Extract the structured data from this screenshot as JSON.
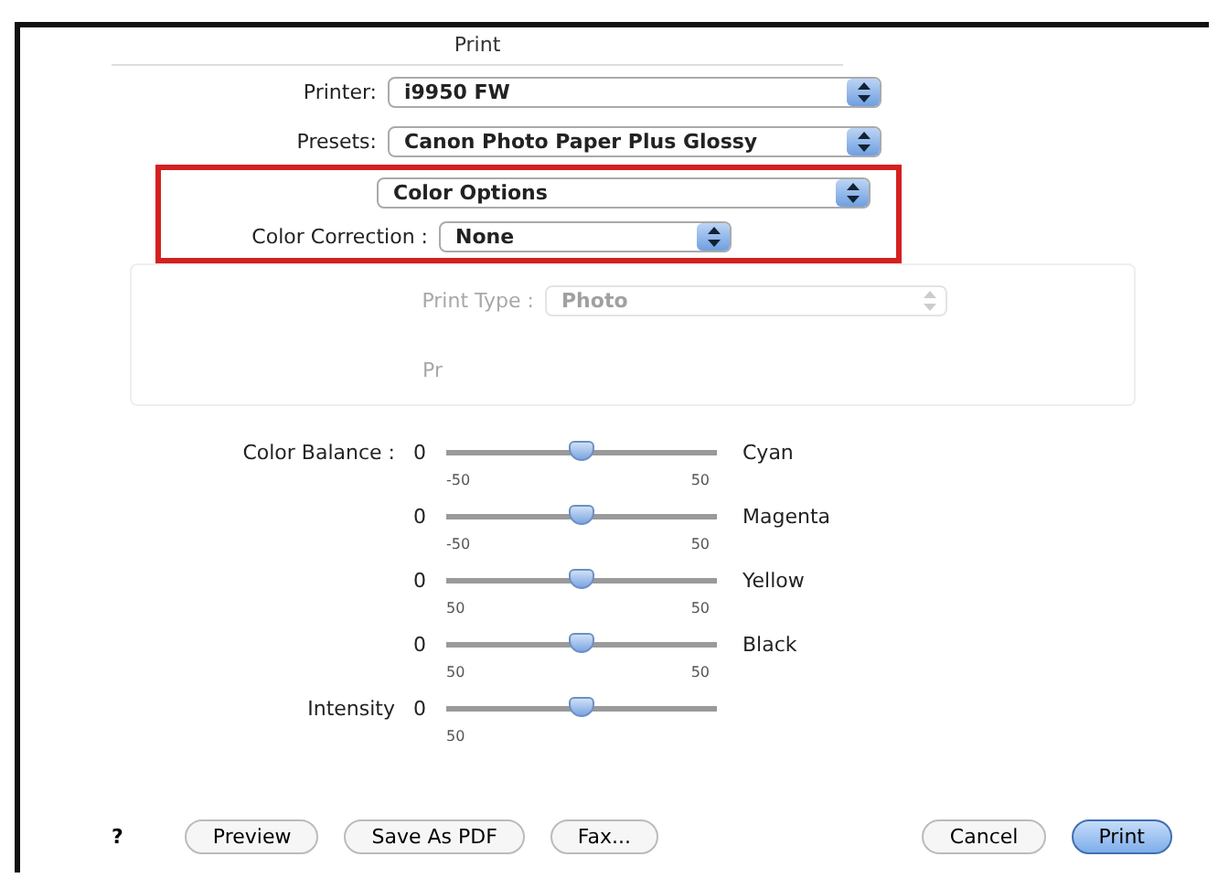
{
  "window": {
    "title": "Print"
  },
  "printer": {
    "label": "Printer:",
    "value": "i9950 FW"
  },
  "presets": {
    "label": "Presets:",
    "value": "Canon Photo Paper Plus Glossy"
  },
  "panel": {
    "value": "Color Options",
    "highlighted": true
  },
  "color_correction": {
    "label": "Color Correction :",
    "value": "None"
  },
  "print_type": {
    "label": "Print Type :",
    "value": "Photo",
    "disabled": true
  },
  "faded_label": {
    "label": "Pr",
    "disabled": true
  },
  "color_balance": {
    "label": "Color Balance :"
  },
  "sliders": [
    {
      "value": "0",
      "level": 0.5,
      "min": "-50",
      "max": "50",
      "name": "Cyan"
    },
    {
      "value": "0",
      "level": 0.5,
      "min": "-50",
      "max": "50",
      "name": "Magenta"
    },
    {
      "value": "0",
      "level": 0.5,
      "min": "50",
      "max": "50",
      "name": "Yellow"
    },
    {
      "value": "0",
      "level": 0.5,
      "min": "50",
      "max": "50",
      "name": "Black"
    },
    {
      "value": "0",
      "level": 0.5,
      "min": "50",
      "label": "Intensity"
    }
  ],
  "buttons": [
    {
      "label": "?",
      "kind": "help"
    },
    {
      "label": "Preview",
      "kind": "plain"
    },
    {
      "label": "Save As PDF",
      "kind": "plain"
    },
    {
      "label": "Fax...",
      "kind": "plain"
    },
    {
      "label": "Cancel",
      "kind": "plain"
    },
    {
      "label": "Print",
      "kind": "default"
    }
  ]
}
